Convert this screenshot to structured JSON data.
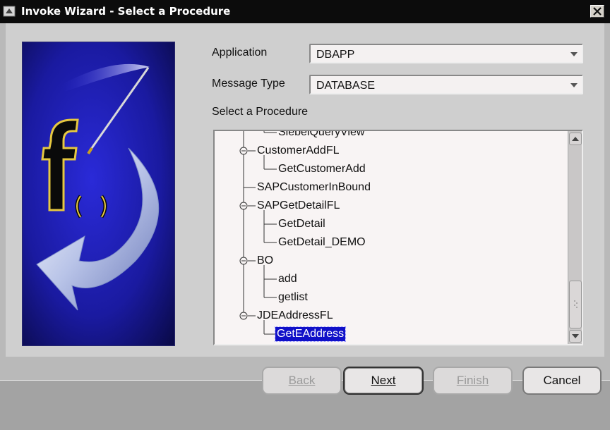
{
  "window": {
    "title": "Invoke Wizard - Select a Procedure",
    "icon": "wizard-app-icon",
    "close_icon": "close-icon"
  },
  "form": {
    "application_label": "Application",
    "application_value": "DBAPP",
    "message_type_label": "Message Type",
    "message_type_value": "DATABASE",
    "procedure_label": "Select a Procedure"
  },
  "tree": {
    "items": [
      {
        "label": "SiebelQueryView",
        "level": 2
      },
      {
        "label": "CustomerAddFL",
        "level": 1,
        "expanded": true
      },
      {
        "label": "GetCustomerAdd",
        "level": 2
      },
      {
        "label": "SAPCustomerInBound",
        "level": 1
      },
      {
        "label": "SAPGetDetailFL",
        "level": 1,
        "expanded": true
      },
      {
        "label": "GetDetail",
        "level": 2
      },
      {
        "label": "GetDetail_DEMO",
        "level": 2
      },
      {
        "label": "BO",
        "level": 1,
        "expanded": true
      },
      {
        "label": "add",
        "level": 2
      },
      {
        "label": "getlist",
        "level": 2
      },
      {
        "label": "JDEAddressFL",
        "level": 1,
        "expanded": true
      },
      {
        "label": "GetEAddress",
        "level": 2,
        "selected": true
      }
    ]
  },
  "buttons": {
    "back": {
      "label": "Back",
      "enabled": false
    },
    "next": {
      "label": "Next",
      "enabled": true
    },
    "finish": {
      "label": "Finish",
      "enabled": false
    },
    "cancel": {
      "label": "Cancel",
      "enabled": true
    }
  },
  "colors": {
    "title_bar": "#0c0c0c",
    "selection": "#1010c8",
    "art_blue": "#1c1ca8"
  }
}
